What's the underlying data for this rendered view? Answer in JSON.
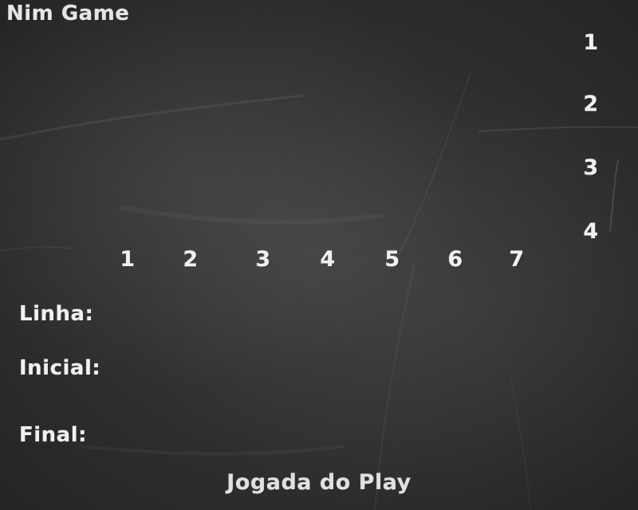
{
  "game": {
    "title": "Nim Game"
  },
  "rows": {
    "labels": [
      "1",
      "2",
      "3",
      "4"
    ]
  },
  "columns": {
    "labels": [
      "1",
      "2",
      "3",
      "4",
      "5",
      "6",
      "7"
    ]
  },
  "panel": {
    "line_label": "Linha:",
    "initial_label": "Inicial:",
    "final_label": "Final:"
  },
  "footer": {
    "turn_text": "Jogada do Play"
  },
  "colors": {
    "board": "#2f2f2f",
    "chalk": "#f1f1f1"
  }
}
